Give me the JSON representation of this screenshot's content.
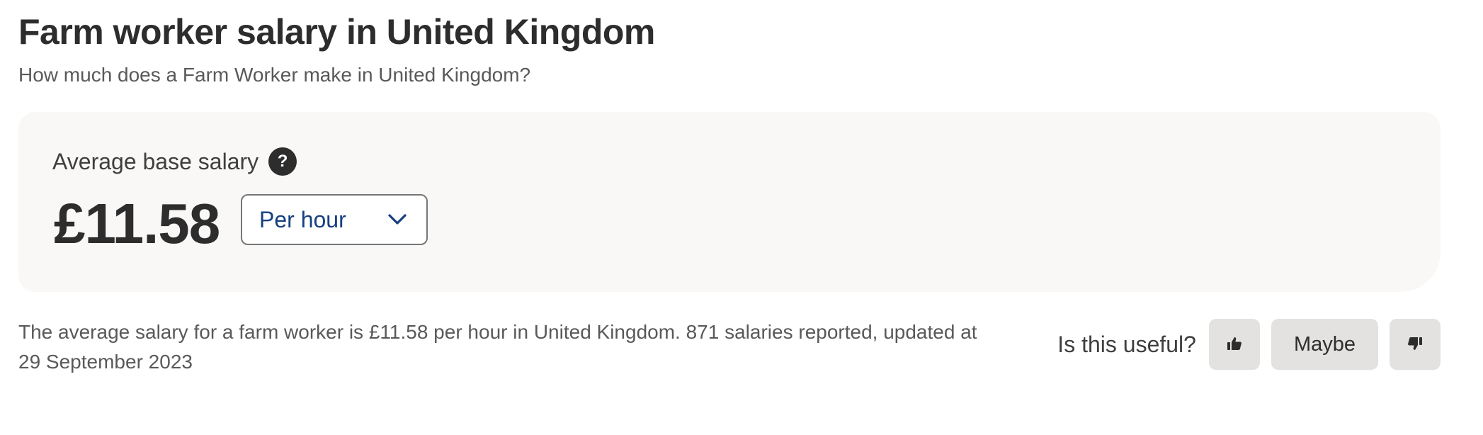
{
  "header": {
    "title": "Farm worker salary in United Kingdom",
    "subtitle": "How much does a Farm Worker make in United Kingdom?"
  },
  "salary_card": {
    "label": "Average base salary",
    "help_icon": "question-circle-icon",
    "value": "£11.58",
    "period": {
      "selected": "Per hour",
      "icon": "chevron-down-icon"
    }
  },
  "summary": {
    "text": "The average salary for a farm worker is £11.58 per hour in United Kingdom.  871 salaries reported, updated at 29 September 2023"
  },
  "feedback": {
    "question": "Is this useful?",
    "thumbs_up_icon": "thumbs-up-icon",
    "maybe_label": "Maybe",
    "thumbs_down_icon": "thumbs-down-icon"
  },
  "colors": {
    "text_primary": "#2d2d2d",
    "text_secondary": "#595959",
    "link_blue": "#164081",
    "card_bg": "#f9f8f6",
    "button_bg": "#e4e2e0"
  }
}
